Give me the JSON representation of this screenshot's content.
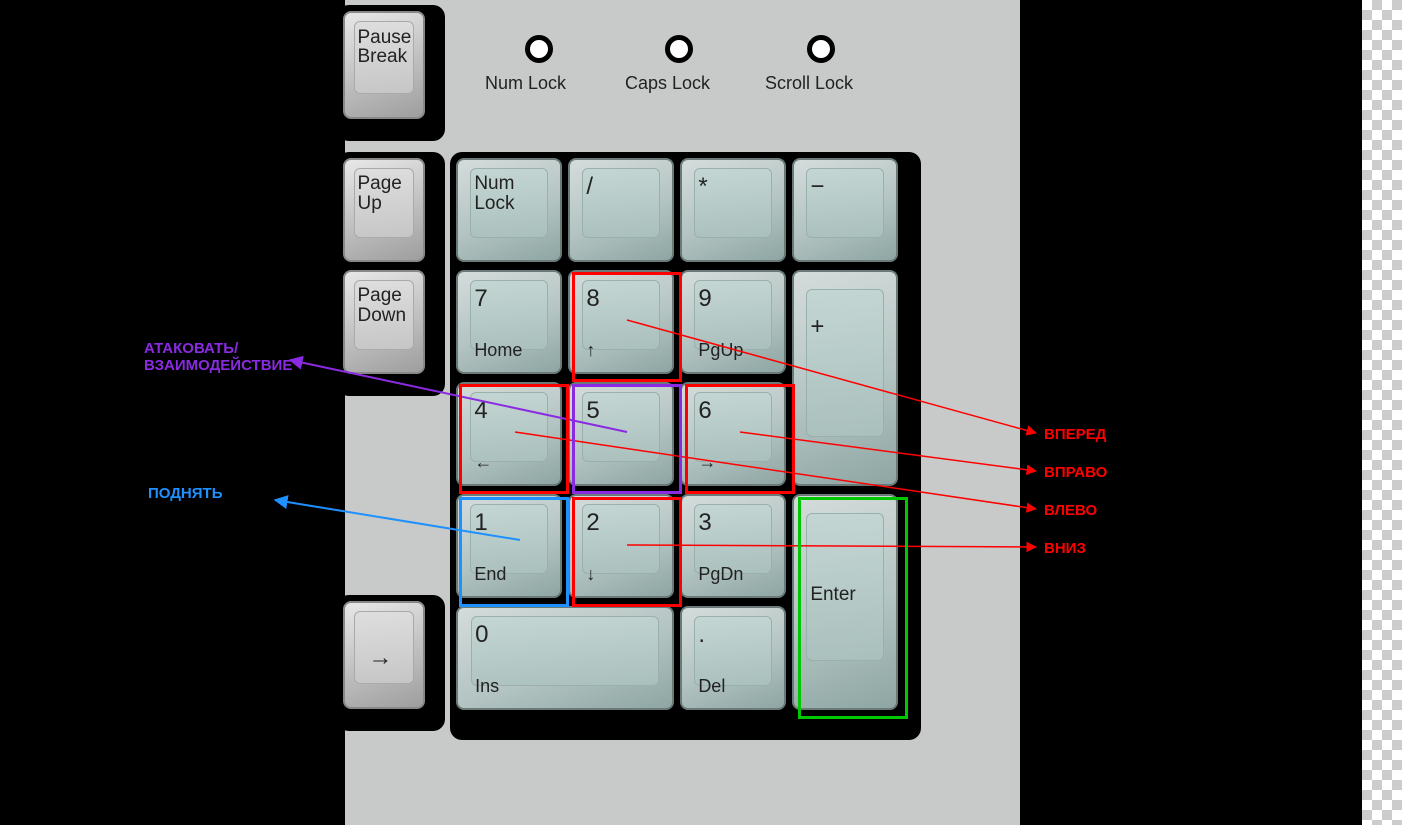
{
  "leds": {
    "num": "Num Lock",
    "caps": "Caps Lock",
    "scroll": "Scroll Lock"
  },
  "leftKeys": {
    "pause": "Pause\nBreak",
    "pgup": "Page\nUp",
    "pgdn": "Page\nDown",
    "right_arrow": "→"
  },
  "numpad": {
    "numlock": "Num\nLock",
    "slash": "/",
    "star": "*",
    "minus": "−",
    "k7": "7",
    "k7s": "Home",
    "k8": "8",
    "k8s": "↑",
    "k9": "9",
    "k9s": "PgUp",
    "plus": "+",
    "k4": "4",
    "k4s": "←",
    "k5": "5",
    "k6": "6",
    "k6s": "→",
    "k1": "1",
    "k1s": "End",
    "k2": "2",
    "k2s": "↓",
    "k3": "3",
    "k3s": "PgDn",
    "enter": "Enter",
    "k0": "0",
    "k0s": "Ins",
    "dot": ".",
    "dots": "Del"
  },
  "annotations": {
    "attack": "АТАКОВАТЬ/\nВЗАИМОДЕЙСТВИЕ",
    "pickup": "ПОДНЯТЬ",
    "forward": "ВПЕРЕД",
    "right": "ВПРАВО",
    "left": "ВЛЕВО",
    "down": "ВНИЗ"
  },
  "colors": {
    "red": "#ff0000",
    "purple": "#8a2be2",
    "blue": "#1e90ff",
    "green": "#00c800"
  }
}
